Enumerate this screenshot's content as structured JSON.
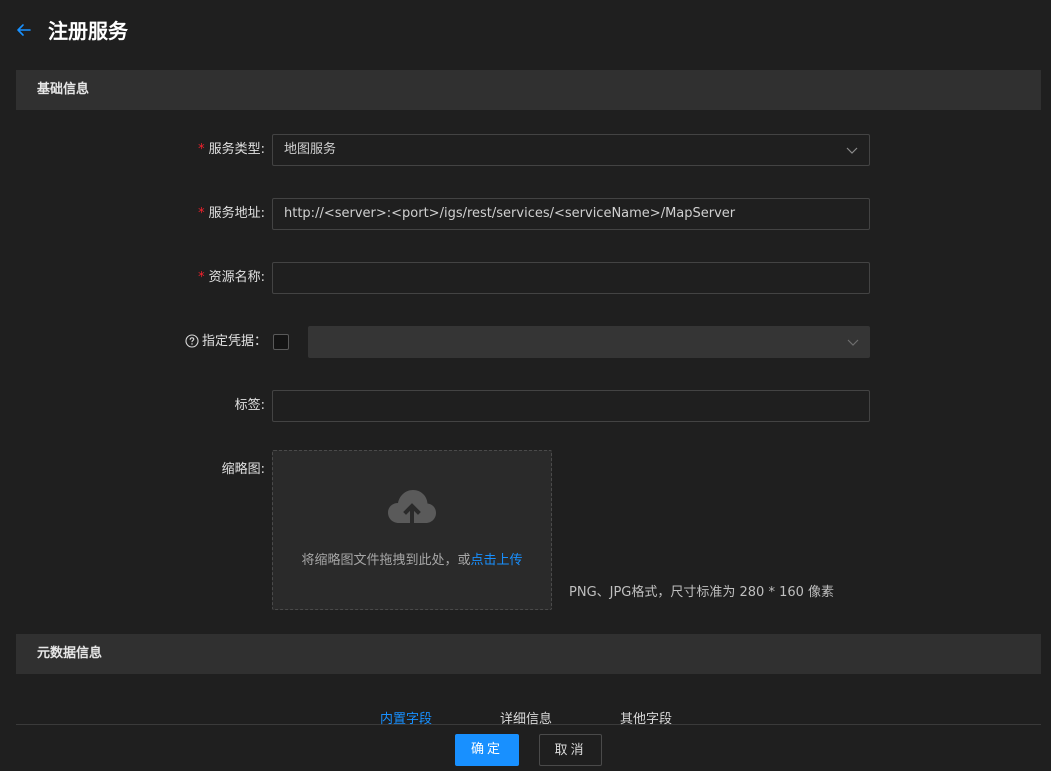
{
  "header": {
    "title": "注册服务"
  },
  "sections": {
    "basic_title": "基础信息",
    "metadata_title": "元数据信息"
  },
  "form": {
    "service_type": {
      "label": "服务类型:",
      "value": "地图服务"
    },
    "service_url": {
      "label": "服务地址:",
      "value": "http://<server>:<port>/igs/rest/services/<serviceName>/MapServer"
    },
    "resource_name": {
      "label": "资源名称:",
      "value": ""
    },
    "credential": {
      "label": "指定凭据：",
      "checked": false,
      "value": ""
    },
    "tags": {
      "label": "标签:",
      "value": ""
    },
    "thumbnail": {
      "label": "缩略图:",
      "drop_text": "将缩略图文件拖拽到此处，或",
      "link_text": "点击上传",
      "hint": "PNG、JPG格式，尺寸标准为 280 * 160 像素"
    }
  },
  "tabs": [
    {
      "label": "内置字段",
      "active": true
    },
    {
      "label": "详细信息",
      "active": false
    },
    {
      "label": "其他字段",
      "active": false
    }
  ],
  "footer": {
    "ok_label": "确定",
    "cancel_label": "取消"
  },
  "colors": {
    "accent": "#1890ff",
    "required": "#f5222d",
    "background": "#1f1f1f",
    "section_bar": "#303030"
  },
  "icons": {
    "back": "arrow-left-icon",
    "chevron": "chevron-down-icon",
    "help": "question-circle-icon",
    "upload": "cloud-upload-icon"
  }
}
